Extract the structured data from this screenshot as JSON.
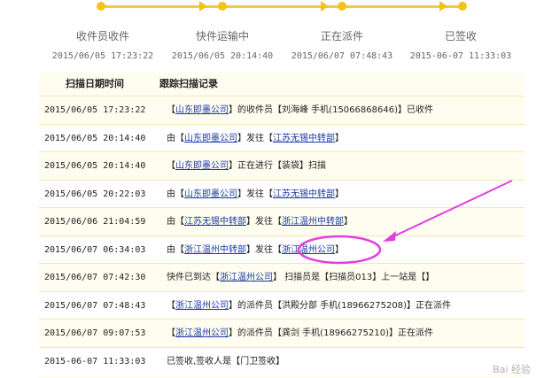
{
  "progress": {
    "stages": [
      {
        "name": "收件员收件",
        "time": "2015/06/05 17:23:22"
      },
      {
        "name": "快件运输中",
        "time": "2015/06/05 20:14:40"
      },
      {
        "name": "正在派件",
        "time": "2015/06/07 07:48:43"
      },
      {
        "name": "已签收",
        "time": "2015-06-07 11:33:03"
      }
    ],
    "color": "#f4c21a"
  },
  "table": {
    "headers": {
      "time": "扫描日期时间",
      "record": "跟踪扫描记录"
    },
    "rows": [
      {
        "time": "2015/06/05 17:23:22",
        "parts": [
          [
            "b",
            "【"
          ],
          [
            "l",
            "山东即墨公司"
          ],
          [
            "b",
            "】的收件员【刘海峰 手机(15066868646)】已收件"
          ]
        ]
      },
      {
        "time": "2015/06/05 20:14:40",
        "parts": [
          [
            "b",
            "由【"
          ],
          [
            "l",
            "山东即墨公司"
          ],
          [
            "b",
            "】发往【"
          ],
          [
            "l",
            "江苏无锡中转部"
          ],
          [
            "b",
            "】"
          ]
        ]
      },
      {
        "time": "2015/06/05 20:14:40",
        "parts": [
          [
            "b",
            "【"
          ],
          [
            "l",
            "山东即墨公司"
          ],
          [
            "b",
            "】正在进行【装袋】扫描"
          ]
        ]
      },
      {
        "time": "2015/06/05 20:22:03",
        "parts": [
          [
            "b",
            "由【"
          ],
          [
            "l",
            "山东即墨公司"
          ],
          [
            "b",
            "】发往【"
          ],
          [
            "l",
            "江苏无锡中转部"
          ],
          [
            "b",
            "】"
          ]
        ]
      },
      {
        "time": "2015/06/06 21:04:59",
        "parts": [
          [
            "b",
            "由【"
          ],
          [
            "l",
            "江苏无锡中转部"
          ],
          [
            "b",
            "】发往【"
          ],
          [
            "l",
            "浙江温州中转部"
          ],
          [
            "b",
            "】"
          ]
        ]
      },
      {
        "time": "2015/06/07 06:34:03",
        "parts": [
          [
            "b",
            "由【"
          ],
          [
            "l",
            "浙江温州中转部"
          ],
          [
            "b",
            "】发往【"
          ],
          [
            "l",
            "浙江温州公司"
          ],
          [
            "b",
            "】"
          ]
        ]
      },
      {
        "time": "2015/06/07 07:42:30",
        "parts": [
          [
            "b",
            "快件已到达【"
          ],
          [
            "l",
            "浙江温州公司"
          ],
          [
            "b",
            "】 扫描员是【扫描员013】上一站是【】"
          ]
        ]
      },
      {
        "time": "2015/06/07 07:48:43",
        "parts": [
          [
            "b",
            "【"
          ],
          [
            "l",
            "浙江温州公司"
          ],
          [
            "b",
            "】的派件员【洪殿分部 手机(18966275208)】正在派件"
          ]
        ]
      },
      {
        "time": "2015/06/07 09:07:53",
        "parts": [
          [
            "b",
            "【"
          ],
          [
            "l",
            "浙江温州公司"
          ],
          [
            "b",
            "】的派件员【龚剑 手机(18966275210)】正在派件"
          ]
        ]
      },
      {
        "time": "2015-06-07 11:33:03",
        "parts": [
          [
            "b",
            "已签收,签收人是【门卫签收】"
          ]
        ]
      }
    ]
  },
  "annotation": {
    "color": "#e33fe0"
  },
  "watermark": "Bai 经验"
}
